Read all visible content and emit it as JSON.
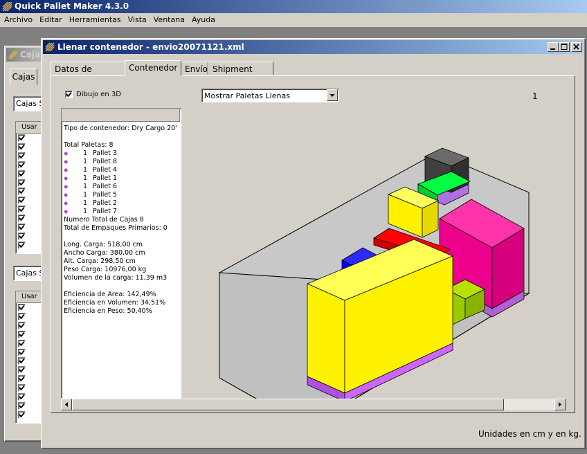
{
  "app": {
    "title": "Quick Pallet Maker 4.3.0",
    "menu": [
      "Archivo",
      "Editar",
      "Herramientas",
      "Vista",
      "Ventana",
      "Ayuda"
    ]
  },
  "bg_window": {
    "title": "Cajas",
    "tab": "Cajas",
    "combo1": "Cajas S",
    "combo2": "Cajas S",
    "usar_header": "Usar"
  },
  "window": {
    "title": "Llenar contenedor - envio20071121.xml",
    "tabs": [
      "Datos de Entrada",
      "Contenedor",
      "Envío",
      "Shipment Data"
    ],
    "active_tab": "Contenedor",
    "checkbox_3d_label": "Dibujo en 3D",
    "checkbox_3d_checked": true,
    "dropdown_value": "Mostrar Paletas Llenas",
    "page_number": "1",
    "units_note": "Unidades en cm y en kg."
  },
  "info": {
    "container_type": "Tipo de contenedor: Dry Cargo 20'",
    "total_pallets": "Total Paletas: 8",
    "pallets": [
      {
        "qty": "1",
        "name": "Pallet 3"
      },
      {
        "qty": "1",
        "name": "Pallet 8"
      },
      {
        "qty": "1",
        "name": "Pallet 4"
      },
      {
        "qty": "1",
        "name": "Pallet 1"
      },
      {
        "qty": "1",
        "name": "Pallet 6"
      },
      {
        "qty": "1",
        "name": "Pallet 5"
      },
      {
        "qty": "1",
        "name": "Pallet 2"
      },
      {
        "qty": "1",
        "name": "Pallet 7"
      }
    ],
    "total_boxes": "Numero Total de Cajas 8",
    "total_primary": "Total de Empaques Primarios: 0",
    "long_carga": "Long. Carga: 518,00 cm",
    "ancho_carga": "Ancho Carga: 380,00 cm",
    "alt_carga": "Alt. Carga: 298,50 cm",
    "peso_carga": "Peso Carga: 10976,00 kg",
    "volumen_carga": "Volumen de la carga: 11,39 m3",
    "ef_area": "Eficiencia de Area: 142,49%",
    "ef_volumen": "Eficiencia en Volumen: 34,51%",
    "ef_peso": "Eficiencia en Peso: 50,40%"
  },
  "colors": {
    "yellow": "#fff200",
    "magenta": "#ec008c",
    "green": "#00ff40",
    "lime": "#99cc00",
    "blue": "#0000ff",
    "red": "#ff0000",
    "dark": "#404040",
    "pallet": "#cc66ff"
  }
}
